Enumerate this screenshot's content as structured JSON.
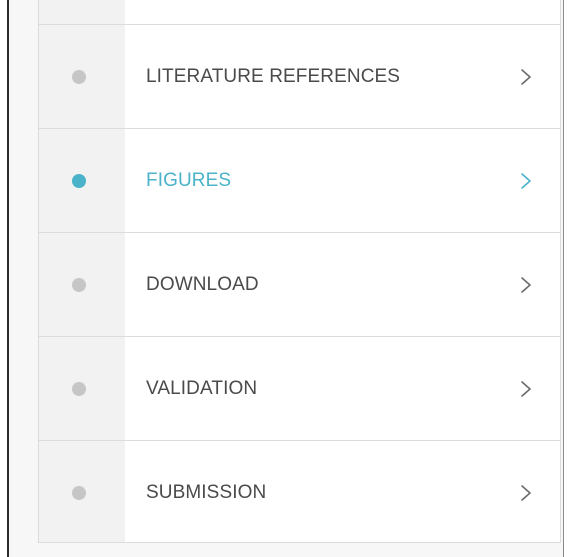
{
  "colors": {
    "active_accent": "#4ab3c9",
    "inactive_dot": "#c6c6c6",
    "label_text": "#4a4a4a",
    "chevron": "#6b6b6b",
    "gutter_background": "#f2f2f2",
    "divider": "#dcdcdc"
  },
  "steps": [
    {
      "label": "LITERATURE REFERENCES",
      "state": "inactive",
      "status_icon": "dot-icon",
      "chevron_icon": "chevron-right-icon"
    },
    {
      "label": "FIGURES",
      "state": "active",
      "status_icon": "dot-icon",
      "chevron_icon": "chevron-right-icon"
    },
    {
      "label": "DOWNLOAD",
      "state": "inactive",
      "status_icon": "dot-icon",
      "chevron_icon": "chevron-right-icon"
    },
    {
      "label": "VALIDATION",
      "state": "inactive",
      "status_icon": "dot-icon",
      "chevron_icon": "chevron-right-icon"
    },
    {
      "label": "SUBMISSION",
      "state": "inactive",
      "status_icon": "dot-icon",
      "chevron_icon": "chevron-right-icon"
    }
  ]
}
